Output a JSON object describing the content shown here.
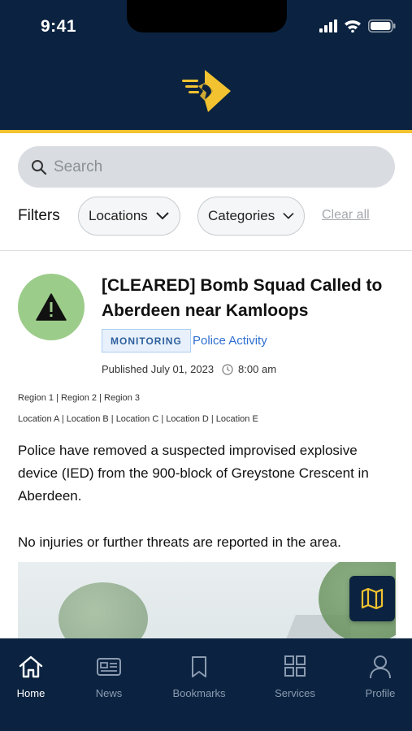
{
  "status_bar": {
    "time": "9:41"
  },
  "search": {
    "placeholder": "Search"
  },
  "filters": {
    "label": "Filters",
    "locations_label": "Locations",
    "categories_label": "Categories",
    "clear_all_label": "Clear all"
  },
  "article": {
    "title": "[CLEARED] Bomb Squad Called to Aberdeen near Kamloops",
    "badge": "MONITORING",
    "category": "Police Activity",
    "published": "Published July 01, 2023",
    "time": "8:00 am",
    "regions": "Region 1 | Region 2 | Region 3",
    "locations": "Location A | Location B | Location C | Location D | Location E",
    "paragraph1": "Police have removed a suspected improvised explosive device (IED) from the 900-block of Greystone Crescent in Aberdeen.",
    "paragraph2": "No injuries or further threats are reported in the area."
  },
  "bottom_nav": {
    "items": [
      {
        "label": "Home",
        "icon": "home-icon",
        "active": true
      },
      {
        "label": "News",
        "icon": "news-icon",
        "active": false
      },
      {
        "label": "Bookmarks",
        "icon": "bookmark-icon",
        "active": false
      },
      {
        "label": "Services",
        "icon": "grid-icon",
        "active": false
      },
      {
        "label": "Profile",
        "icon": "user-icon",
        "active": false
      }
    ]
  },
  "colors": {
    "header": "#0b2340",
    "accent_stripe": "#f2c230",
    "alert_circle": "#9ccc8a",
    "link": "#2f6fd1"
  }
}
